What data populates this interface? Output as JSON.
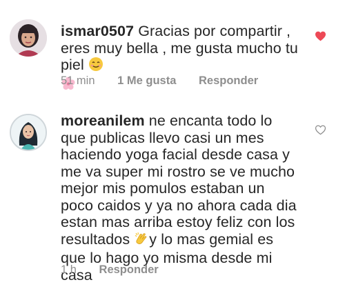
{
  "comments": [
    {
      "username": "ismar0507",
      "text": "Gracias por compartir , eres muy bella , me gusta mucho tu piel",
      "time": "51 min",
      "likes": "1 Me gusta",
      "reply": "Responder",
      "liked": true,
      "emojis": [
        "smiling-face-emoji",
        "cherry-blossom-emoji"
      ]
    },
    {
      "username": "moreanilem",
      "text_part1": "ne encanta  todo lo que publicas llevo casi un mes haciendo yoga facial desde casa y me va super mi rostro se ve mucho mejor mis pomulos estaban un poco caidos y ya no ahora cada dia estan mas arriba estoy feliz con los resultados",
      "text_part2": "y lo mas gemial es que lo hago yo misma desde mi casa",
      "time": "1 h",
      "reply": "Responder",
      "liked": false,
      "emojis": [
        "clapping-hands-emoji"
      ]
    }
  ],
  "colors": {
    "heart_liked": "#ed4956",
    "heart_outline": "#8e8e8e",
    "meta": "#8e8e8e"
  }
}
